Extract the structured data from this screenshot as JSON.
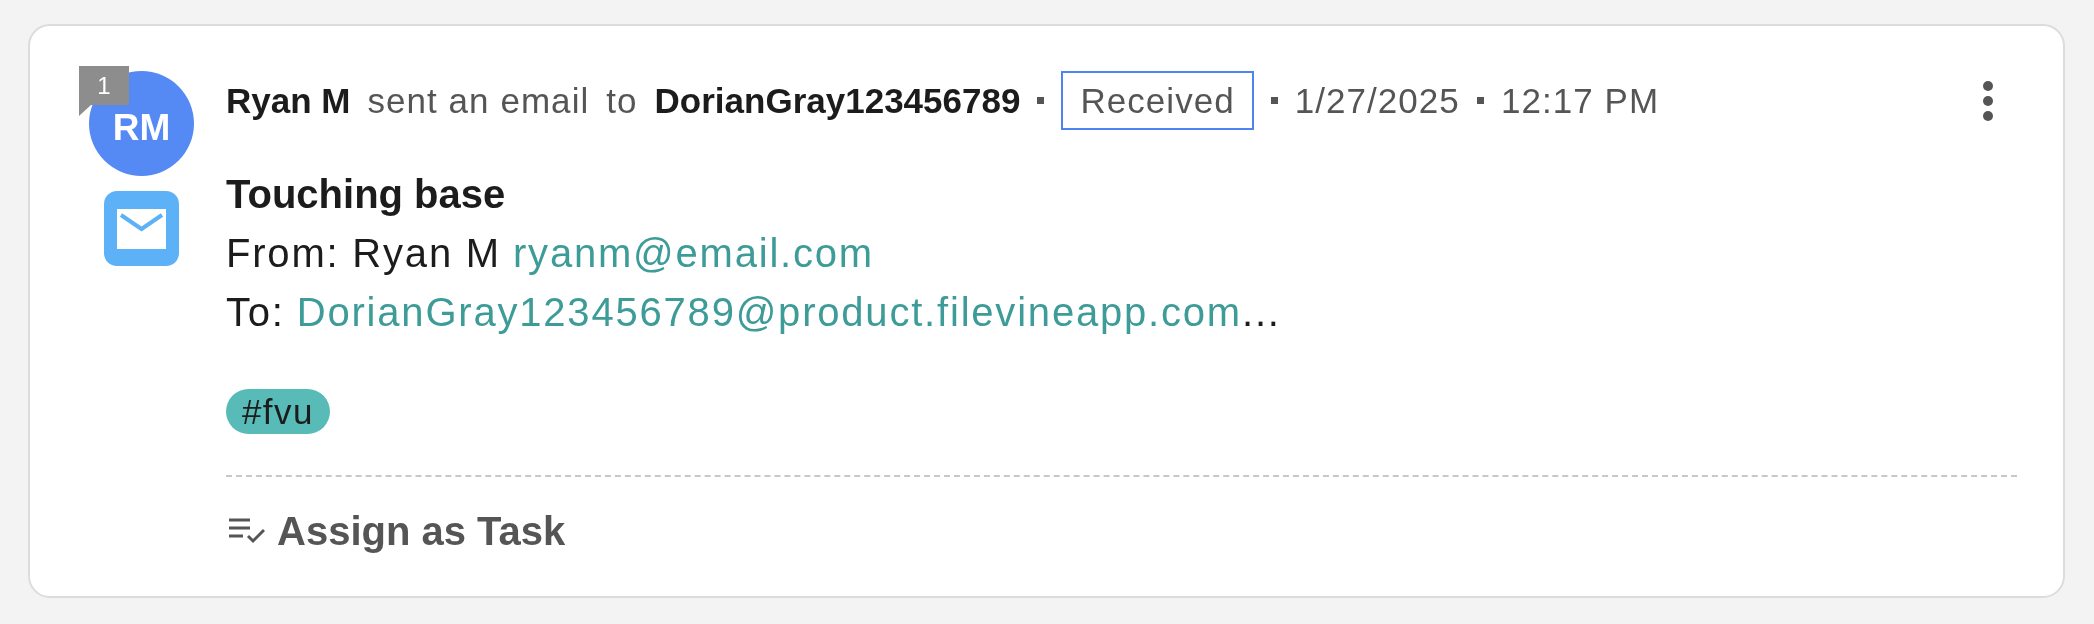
{
  "activity": {
    "kind": "email",
    "avatar": {
      "initials": "RM",
      "badge": "1"
    },
    "header": {
      "sender": "Ryan M",
      "action": "sent an email",
      "preposition": "to",
      "recipient": "DorianGray123456789",
      "status": "Received",
      "date": "1/27/2025",
      "time": "12:17 PM"
    },
    "subject": "Touching base",
    "from": {
      "label": "From: Ryan M",
      "email": "ryanm@email.com"
    },
    "to": {
      "label": "To:",
      "email": "DorianGray123456789@product.filevineapp.com",
      "ellipsis": "..."
    },
    "tags": [
      "#fvu"
    ],
    "actions": [
      {
        "kind": "assign-task",
        "label": "Assign as Task"
      }
    ]
  }
}
